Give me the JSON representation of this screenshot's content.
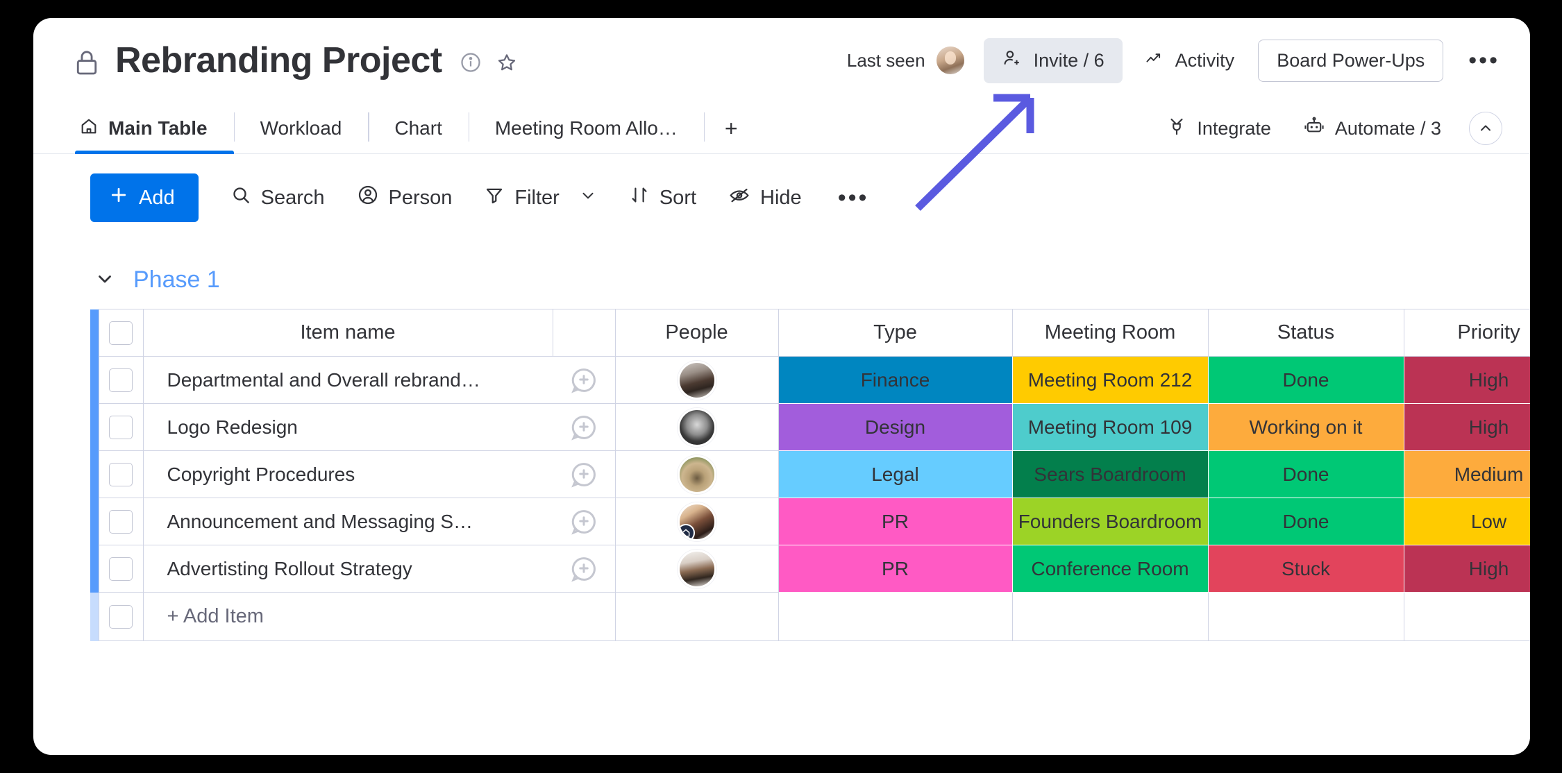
{
  "header": {
    "lock_icon": "lock-icon",
    "title": "Rebranding Project",
    "info_icon": "info-icon",
    "star_icon": "star-icon",
    "last_seen_label": "Last seen",
    "invite_label": "Invite / 6",
    "invite_icon": "person-add-icon",
    "activity_label": "Activity",
    "activity_icon": "activity-trend-icon",
    "powerups_label": "Board Power-Ups",
    "more_label": "•••"
  },
  "tabs": {
    "items": [
      {
        "label": "Main Table",
        "icon": "home-icon",
        "active": true
      },
      {
        "label": "Workload",
        "icon": "",
        "active": false
      },
      {
        "label": "Chart",
        "icon": "",
        "active": false
      },
      {
        "label": "Meeting Room Allo…",
        "icon": "",
        "active": false
      }
    ],
    "add_label": "+",
    "right_items": [
      {
        "label": "Integrate",
        "icon": "plug-icon"
      },
      {
        "label": "Automate / 3",
        "icon": "robot-icon"
      }
    ],
    "collapse_icon": "chevron-up-icon"
  },
  "toolbar": {
    "add_label": "Add",
    "items": [
      {
        "label": "Search",
        "icon": "search-icon"
      },
      {
        "label": "Person",
        "icon": "person-icon"
      },
      {
        "label": "Filter",
        "icon": "filter-icon",
        "chevron": true
      },
      {
        "label": "Sort",
        "icon": "sort-icon"
      },
      {
        "label": "Hide",
        "icon": "eye-off-icon"
      }
    ],
    "more_label": "•••"
  },
  "group": {
    "name": "Phase 1",
    "collapse_icon": "chevron-down-icon",
    "accent_color": "#579bfc"
  },
  "table": {
    "columns": [
      "Item name",
      "People",
      "Type",
      "Meeting Room",
      "Status",
      "Priority"
    ],
    "add_item_label": "+ Add Item",
    "rows": [
      {
        "name": "Departmental and Overall rebrand…",
        "person": "avatar-woman-dark-hair",
        "type": {
          "label": "Finance",
          "color": "#0086c0"
        },
        "room": {
          "label": "Meeting Room 212",
          "color": "#ffcb00"
        },
        "status": {
          "label": "Done",
          "color": "#00c875"
        },
        "priority": {
          "label": "High",
          "color": "#bb3354"
        }
      },
      {
        "name": "Logo Redesign",
        "person": "avatar-woman-smiling-bw",
        "type": {
          "label": "Design",
          "color": "#a25ddc"
        },
        "room": {
          "label": "Meeting Room 109",
          "color": "#4ecccc"
        },
        "status": {
          "label": "Working on it",
          "color": "#fdab3d"
        },
        "priority": {
          "label": "High",
          "color": "#bb3354"
        }
      },
      {
        "name": "Copyright Procedures",
        "person": "avatar-pug-dog",
        "type": {
          "label": "Legal",
          "color": "#66ccff"
        },
        "room": {
          "label": "Sears Boardroom",
          "color": "#037f4c"
        },
        "status": {
          "label": "Done",
          "color": "#00c875"
        },
        "priority": {
          "label": "Medium",
          "color": "#fdab3d"
        }
      },
      {
        "name": "Announcement and Messaging S…",
        "person": "avatar-woman-long-hair",
        "person_badge": "home-badge-icon",
        "type": {
          "label": "PR",
          "color": "#ff5ac4"
        },
        "room": {
          "label": "Founders Boardroom",
          "color": "#9cd326"
        },
        "status": {
          "label": "Done",
          "color": "#00c875"
        },
        "priority": {
          "label": "Low",
          "color": "#ffcb00"
        }
      },
      {
        "name": "Advertisting Rollout Strategy",
        "person": "avatar-man",
        "type": {
          "label": "PR",
          "color": "#ff5ac4"
        },
        "room": {
          "label": "Conference Room",
          "color": "#00c875"
        },
        "status": {
          "label": "Stuck",
          "color": "#e2445c"
        },
        "priority": {
          "label": "High",
          "color": "#bb3354"
        }
      }
    ]
  },
  "annotation": {
    "arrow_color": "#5a5ae0",
    "target": "invite-button"
  },
  "colors": {
    "accent_blue": "#0073ea",
    "group_blue": "#579bfc",
    "text": "#323338",
    "muted": "#676879",
    "border": "#d0d4e4"
  }
}
